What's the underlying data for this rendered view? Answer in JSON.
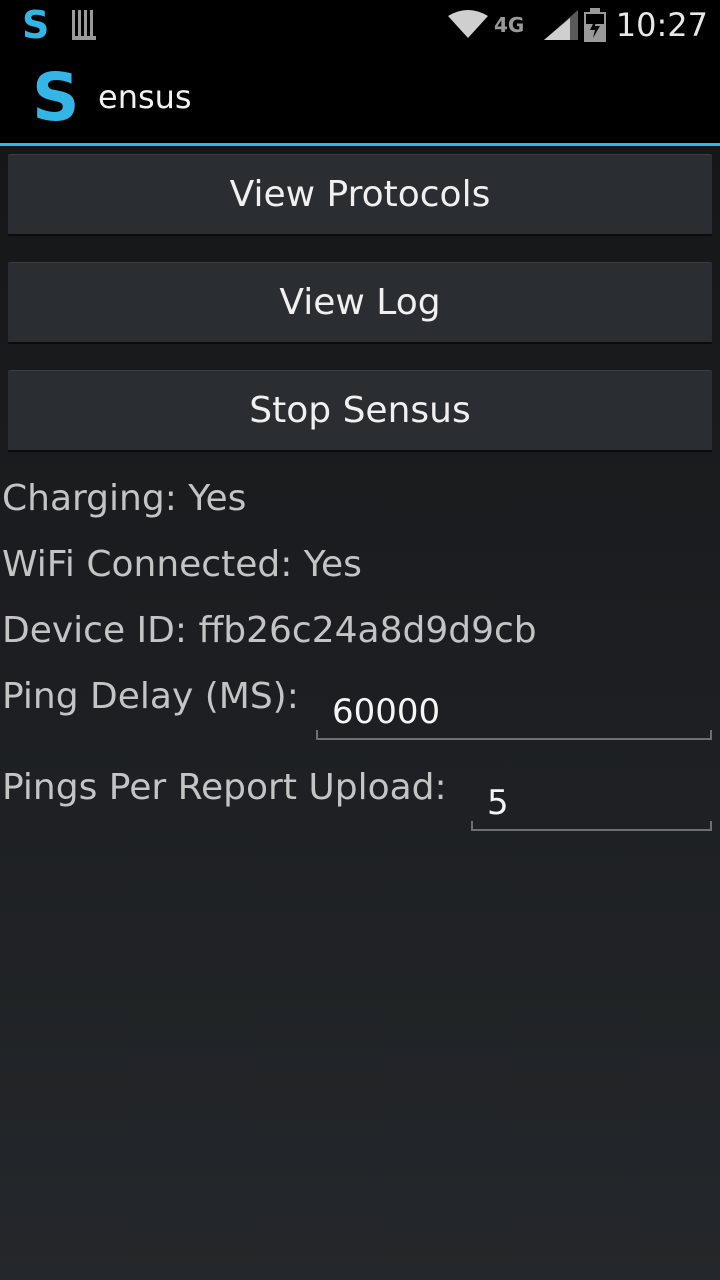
{
  "status_bar": {
    "notification_icons": [
      "sensus-notification-icon",
      "sd-card-icon"
    ],
    "notification_s": "S",
    "network_label": "4G",
    "time": "10:27",
    "icons": [
      "wifi-icon",
      "lte-icon",
      "signal-icon",
      "battery-charging-icon"
    ]
  },
  "action_bar": {
    "logo": "S",
    "title": "ensus",
    "accent_color": "#33b5e5"
  },
  "buttons": {
    "view_protocols": "View Protocols",
    "view_log": "View Log",
    "stop_sensus": "Stop Sensus"
  },
  "info": {
    "charging": "Charging: Yes",
    "wifi": "WiFi Connected: Yes",
    "device_id": "Device ID: ffb26c24a8d9d9cb"
  },
  "settings": {
    "ping_delay_label": "Ping Delay (MS):",
    "ping_delay_value": "60000",
    "pings_per_upload_label": "Pings Per Report Upload:",
    "pings_per_upload_value": "5"
  }
}
